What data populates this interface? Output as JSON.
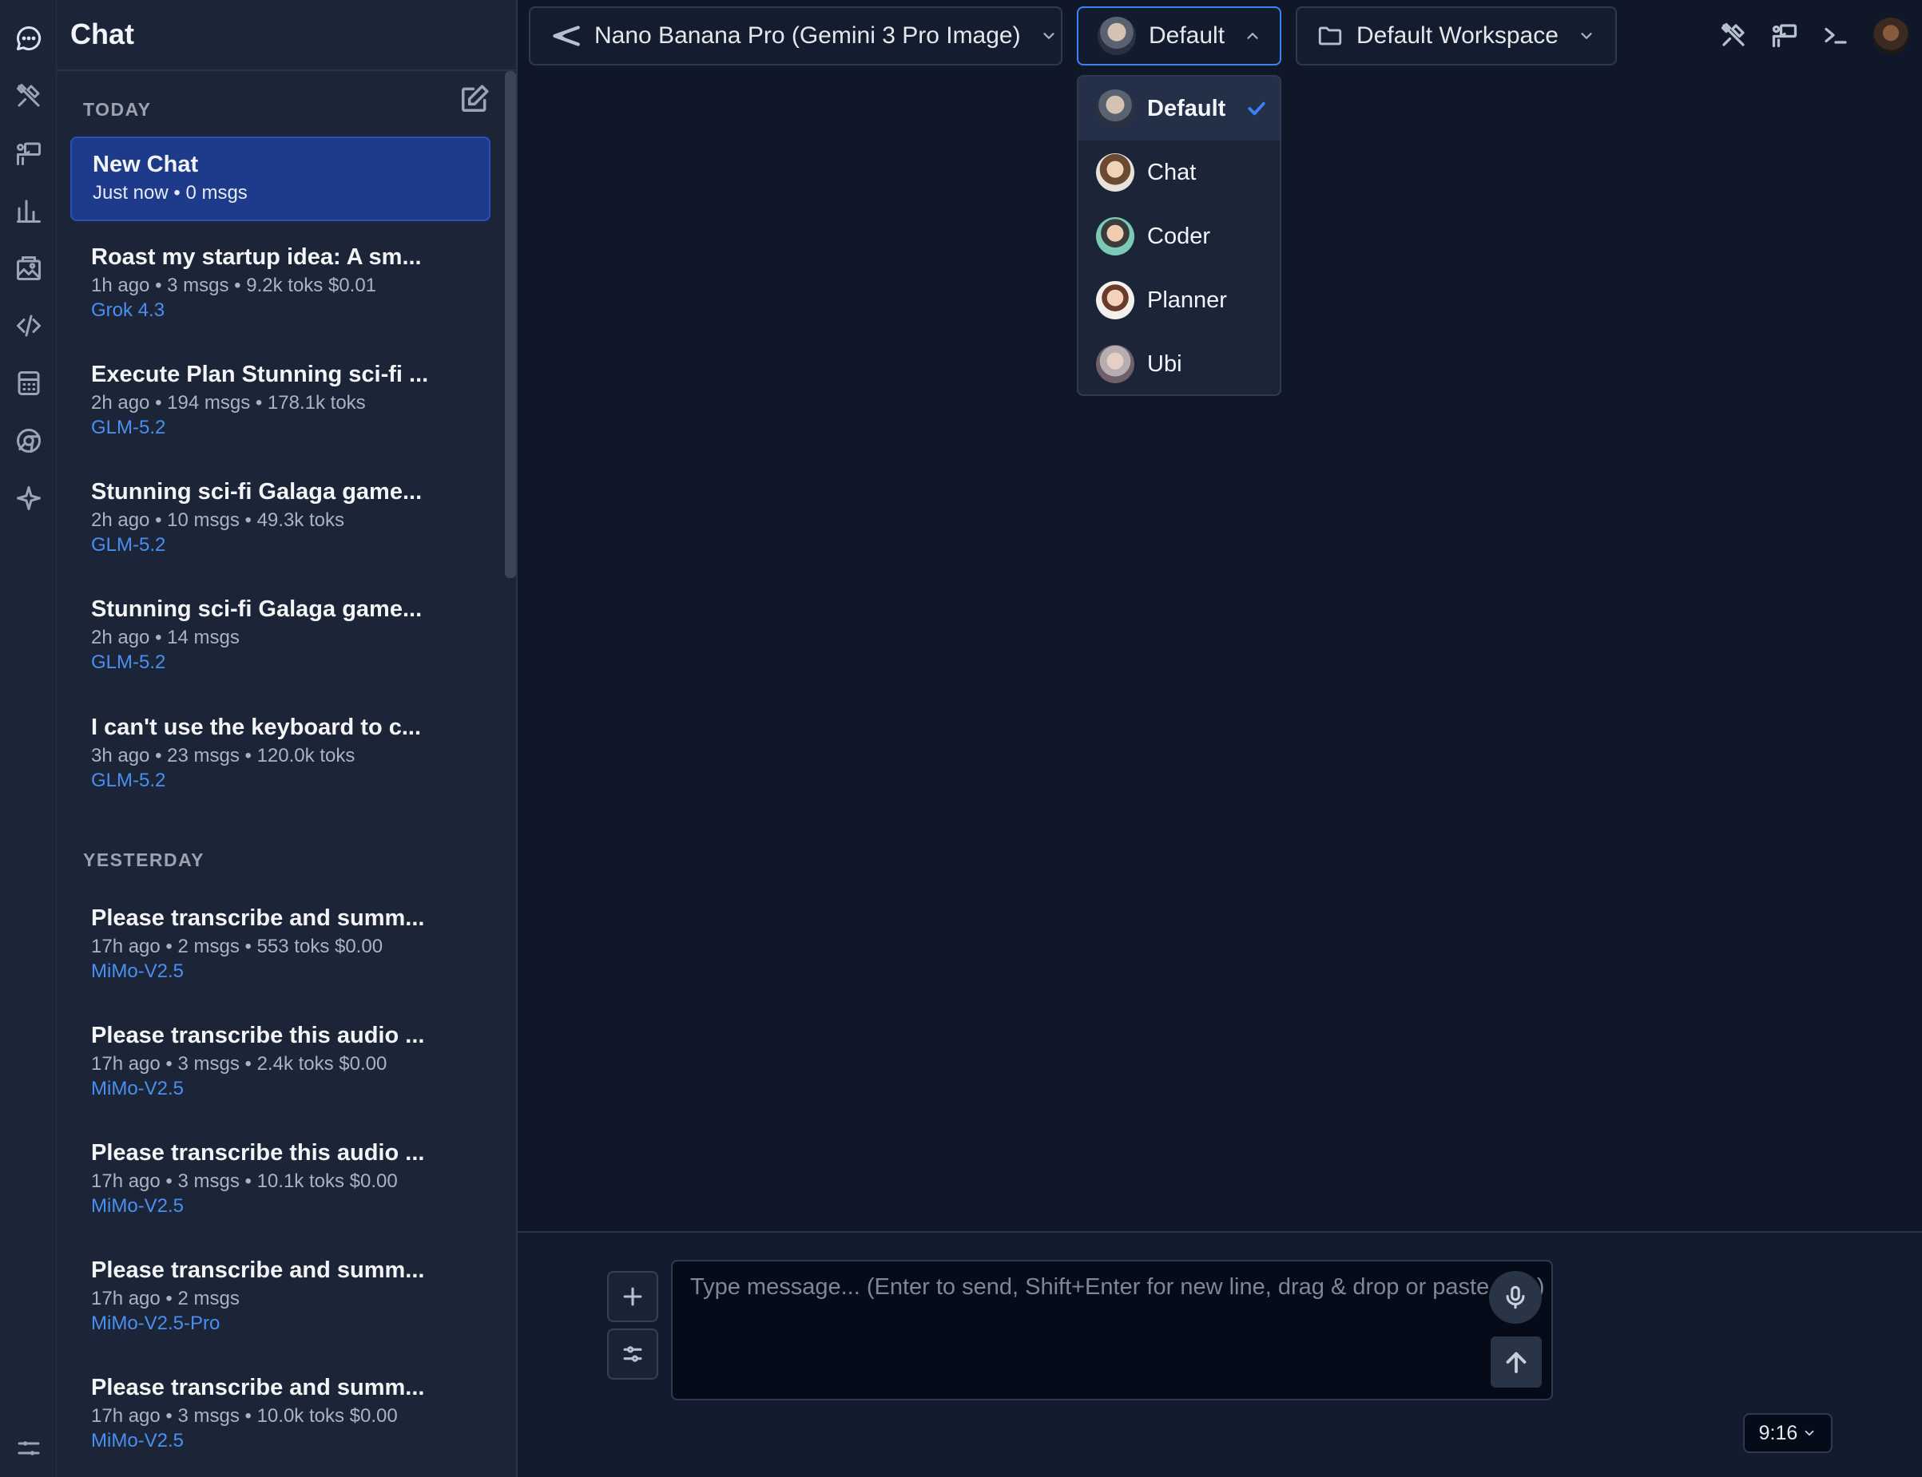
{
  "sidebar": {
    "title": "Chat",
    "today_label": "TODAY",
    "yesterday_label": "YESTERDAY",
    "today": [
      {
        "title": "New Chat",
        "meta": "Just now • 0 msgs",
        "model": ""
      },
      {
        "title": "Roast my startup idea: A sm...",
        "meta": "1h ago • 3 msgs • 9.2k toks $0.01",
        "model": "Grok 4.3"
      },
      {
        "title": "Execute Plan Stunning sci-fi ...",
        "meta": "2h ago • 194 msgs • 178.1k toks",
        "model": "GLM-5.2"
      },
      {
        "title": "Stunning sci-fi Galaga game...",
        "meta": "2h ago • 10 msgs • 49.3k toks",
        "model": "GLM-5.2"
      },
      {
        "title": "Stunning sci-fi Galaga game...",
        "meta": "2h ago • 14 msgs",
        "model": "GLM-5.2"
      },
      {
        "title": "I can't use the keyboard to c...",
        "meta": "3h ago • 23 msgs • 120.0k toks",
        "model": "GLM-5.2"
      }
    ],
    "yesterday": [
      {
        "title": "Please transcribe and summ...",
        "meta": "17h ago • 2 msgs • 553 toks $0.00",
        "model": "MiMo-V2.5"
      },
      {
        "title": "Please transcribe this audio ...",
        "meta": "17h ago • 3 msgs • 2.4k toks $0.00",
        "model": "MiMo-V2.5"
      },
      {
        "title": "Please transcribe this audio ...",
        "meta": "17h ago • 3 msgs • 10.1k toks $0.00",
        "model": "MiMo-V2.5"
      },
      {
        "title": "Please transcribe and summ...",
        "meta": "17h ago • 2 msgs",
        "model": "MiMo-V2.5-Pro"
      },
      {
        "title": "Please transcribe and summ...",
        "meta": "17h ago • 3 msgs • 10.0k toks $0.00",
        "model": "MiMo-V2.5"
      }
    ]
  },
  "topbar": {
    "model": "Nano Banana Pro (Gemini 3 Pro Image)",
    "persona": "Default",
    "workspace": "Default Workspace"
  },
  "persona_menu": {
    "selected": "Default",
    "items": [
      "Default",
      "Chat",
      "Coder",
      "Planner",
      "Ubi"
    ]
  },
  "composer": {
    "placeholder": "Type message... (Enter to send, Shift+Enter for new line, drag & drop or paste files)",
    "aspect_ratio": "9:16"
  },
  "colors": {
    "background": "#0f1729",
    "sidebar": "#1c2537",
    "selected_chat": "#1e3a8a",
    "accent": "#3b82f6",
    "model_link": "#4a8ff0"
  },
  "icons": {
    "rail": [
      "chat-bubble-icon",
      "tools-icon",
      "presentation-icon",
      "bar-chart-icon",
      "image-gallery-icon",
      "code-icon",
      "calculator-icon",
      "browser-icon",
      "sparkle-icon",
      "sliders-icon"
    ],
    "topbar": [
      "tools-icon",
      "presentation-icon",
      "terminal-icon",
      "user-avatar"
    ]
  }
}
